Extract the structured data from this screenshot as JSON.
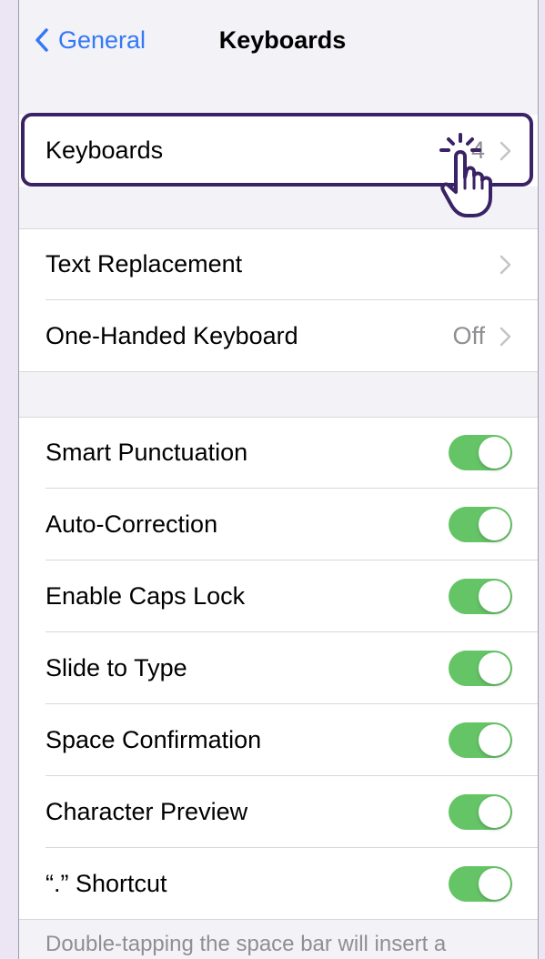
{
  "navbar": {
    "back_label": "General",
    "title": "Keyboards"
  },
  "keyboards_row": {
    "label": "Keyboards",
    "value": "4"
  },
  "group2": [
    {
      "label": "Text Replacement",
      "value": ""
    },
    {
      "label": "One-Handed Keyboard",
      "value": "Off"
    }
  ],
  "toggles": [
    {
      "label": "Smart Punctuation",
      "on": true
    },
    {
      "label": "Auto-Correction",
      "on": true
    },
    {
      "label": "Enable Caps Lock",
      "on": true
    },
    {
      "label": "Slide to Type",
      "on": true
    },
    {
      "label": "Space Confirmation",
      "on": true
    },
    {
      "label": "Character Preview",
      "on": true
    },
    {
      "label": "“.” Shortcut",
      "on": true
    }
  ],
  "footer": {
    "text": "Double-tapping the space bar will insert a"
  },
  "colors": {
    "accent": "#3478F6",
    "toggle_on": "#65C466",
    "highlight": "#3A2266",
    "background": "#F2F2F7"
  },
  "icons": {
    "back": "chevron-left-icon",
    "disclosure": "chevron-right-icon",
    "cursor": "tap-hand-icon"
  }
}
